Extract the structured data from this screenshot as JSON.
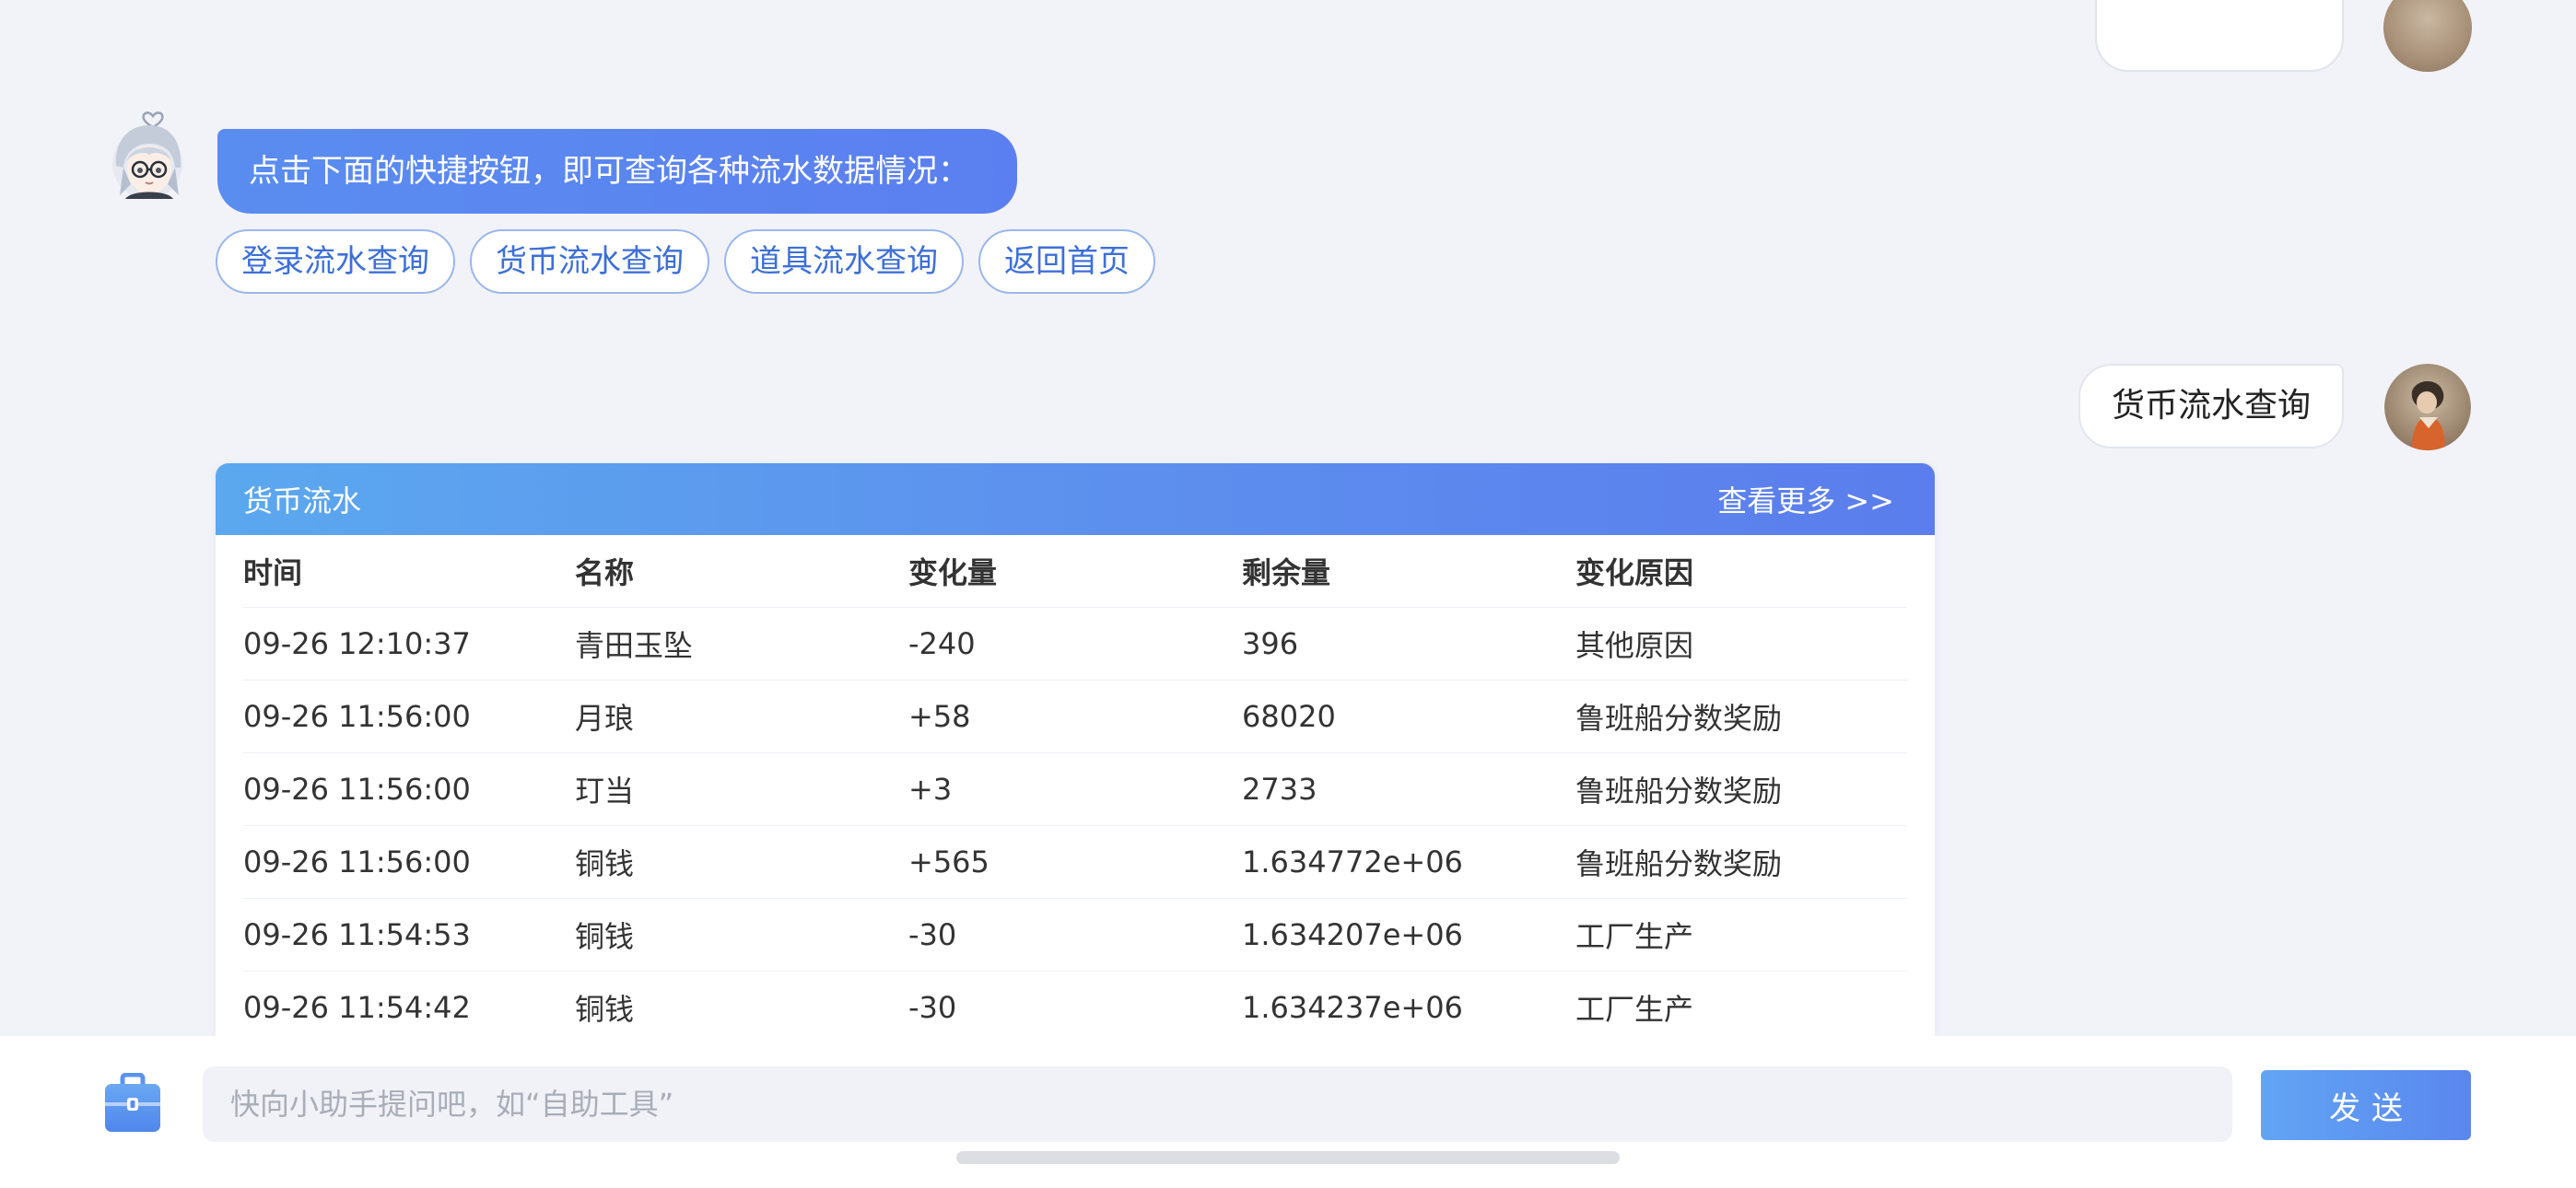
{
  "bot_message": {
    "text": "点击下面的快捷按钮，即可查询各种流水数据情况："
  },
  "quick_buttons": [
    {
      "label": "登录流水查询"
    },
    {
      "label": "货币流水查询"
    },
    {
      "label": "道具流水查询"
    },
    {
      "label": "返回首页"
    }
  ],
  "user_message": {
    "text": "货币流水查询"
  },
  "currency_card": {
    "title": "货币流水",
    "more_label": "查看更多 >>",
    "columns": [
      "时间",
      "名称",
      "变化量",
      "剩余量",
      "变化原因"
    ],
    "rows": [
      [
        "09-26 12:10:37",
        "青田玉坠",
        "-240",
        "396",
        "其他原因"
      ],
      [
        "09-26 11:56:00",
        "月琅",
        "+58",
        "68020",
        "鲁班船分数奖励"
      ],
      [
        "09-26 11:56:00",
        "玎当",
        "+3",
        "2733",
        "鲁班船分数奖励"
      ],
      [
        "09-26 11:56:00",
        "铜钱",
        "+565",
        "1.634772e+06",
        "鲁班船分数奖励"
      ],
      [
        "09-26 11:54:53",
        "铜钱",
        "-30",
        "1.634207e+06",
        "工厂生产"
      ],
      [
        "09-26 11:54:42",
        "铜钱",
        "-30",
        "1.634237e+06",
        "工厂生产"
      ]
    ]
  },
  "input_bar": {
    "placeholder": "快向小助手提问吧，如“自助工具”",
    "send_label": "发送"
  },
  "icons": {
    "toolbox": "toolbox-icon",
    "bot_avatar": "bot-avatar",
    "user_avatar": "user-avatar"
  },
  "colors": {
    "accent": "#5b7ff0",
    "background": "#f1f3f8"
  }
}
